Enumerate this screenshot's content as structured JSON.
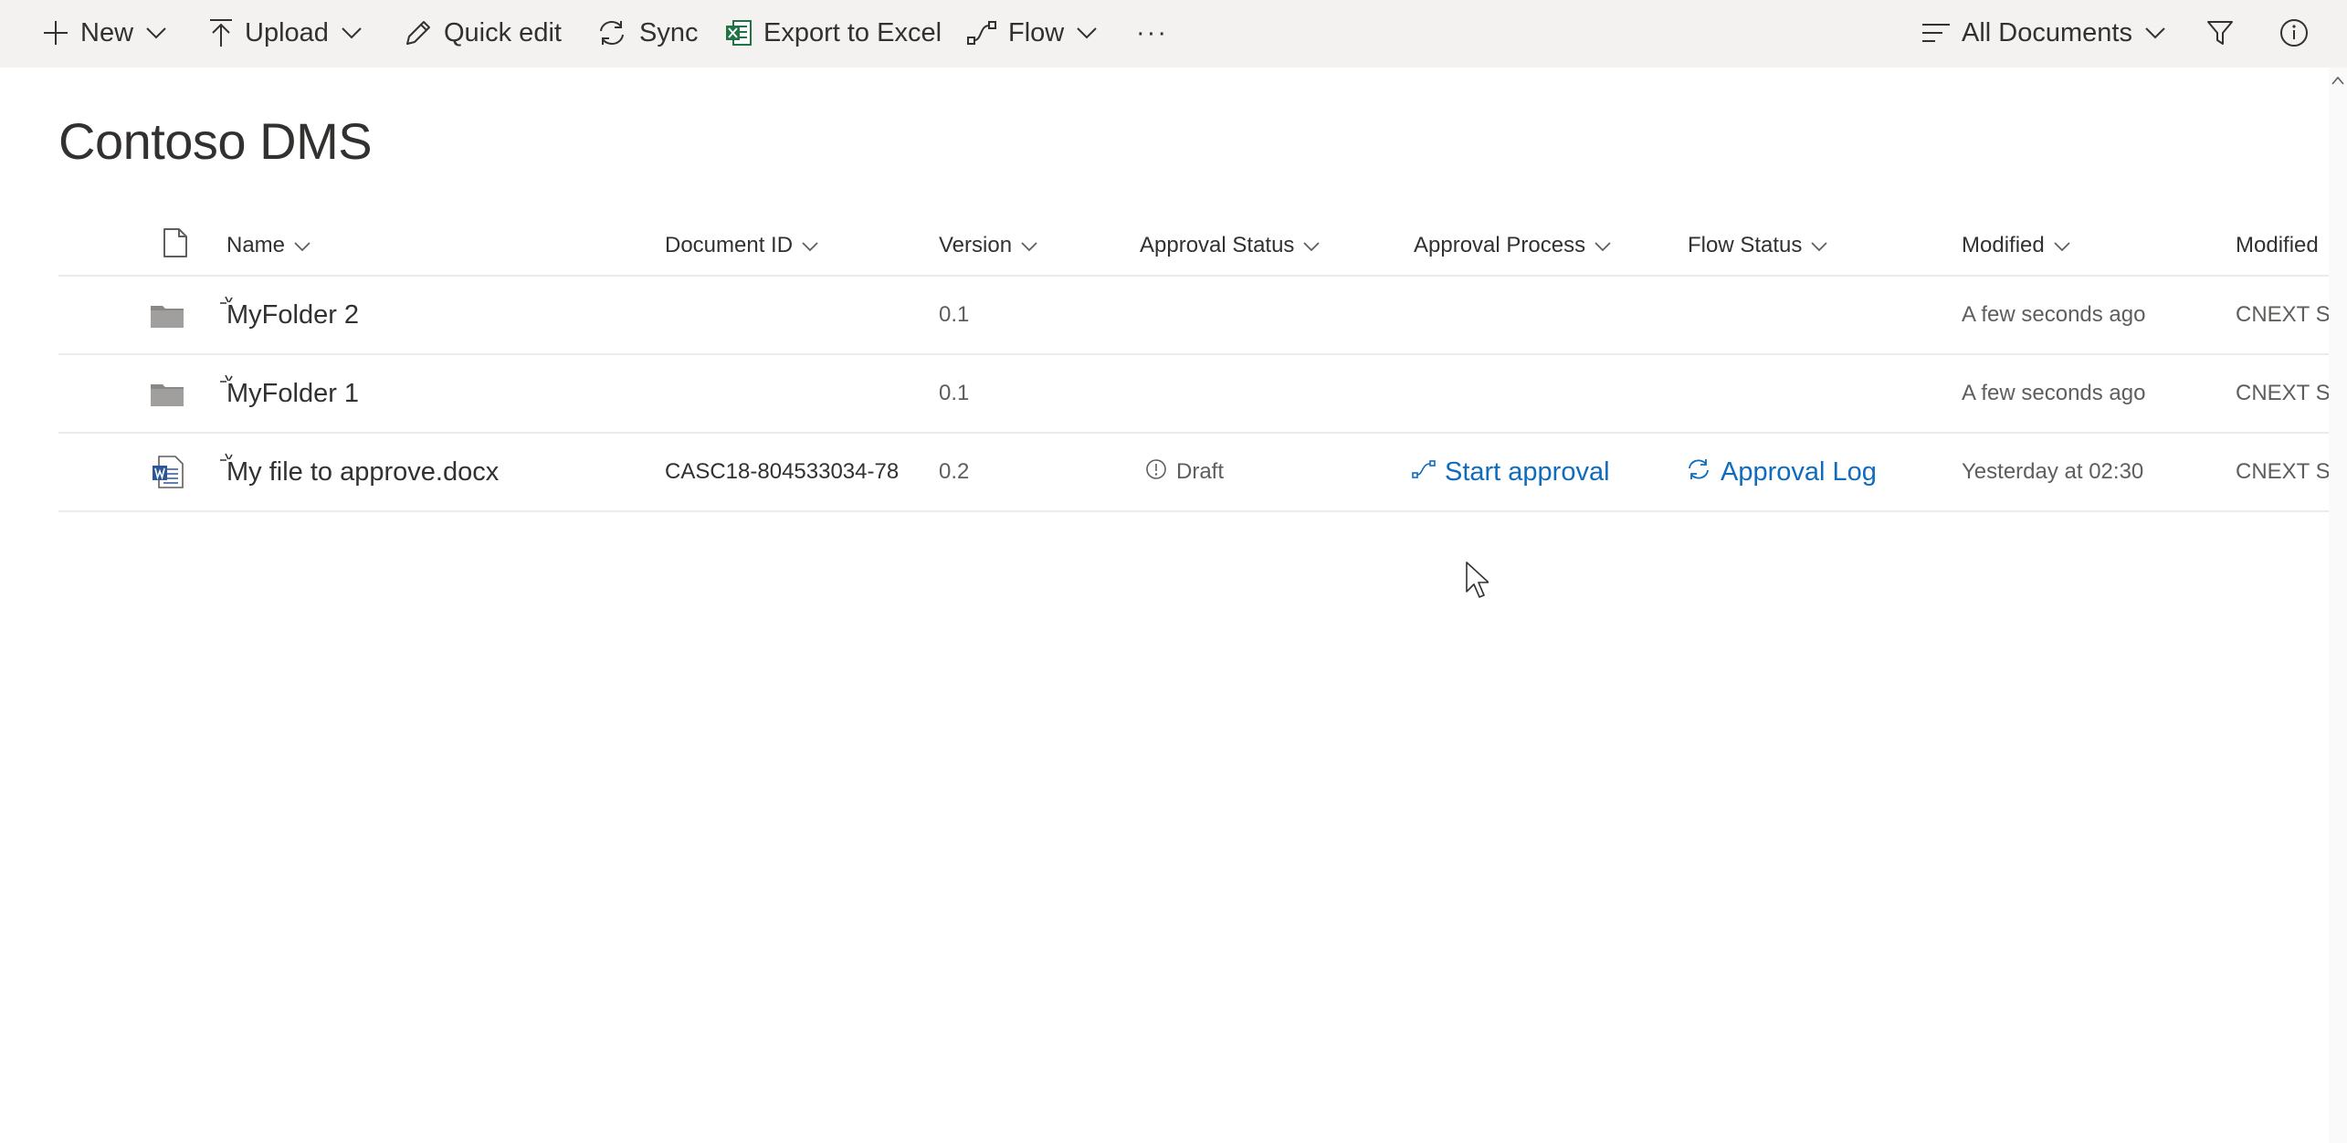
{
  "command_bar": {
    "new_label": "New",
    "upload_label": "Upload",
    "quick_edit_label": "Quick edit",
    "sync_label": "Sync",
    "export_label": "Export to Excel",
    "flow_label": "Flow",
    "more_label": "···",
    "view_label": "All Documents"
  },
  "library": {
    "title": "Contoso DMS"
  },
  "columns": {
    "name": "Name",
    "document_id": "Document ID",
    "version": "Version",
    "approval_status": "Approval Status",
    "approval_process": "Approval Process",
    "flow_status": "Flow Status",
    "modified": "Modified",
    "modified_by": "Modified"
  },
  "rows": [
    {
      "type": "folder",
      "name": "MyFolder 2",
      "document_id": "",
      "version": "0.1",
      "approval_status": "",
      "approval_process": "",
      "flow_status": "",
      "modified": "A few seconds ago",
      "modified_by": "CNEXT Su"
    },
    {
      "type": "folder",
      "name": "MyFolder 1",
      "document_id": "",
      "version": "0.1",
      "approval_status": "",
      "approval_process": "",
      "flow_status": "",
      "modified": "A few seconds ago",
      "modified_by": "CNEXT Su"
    },
    {
      "type": "word",
      "name": "My file to approve.docx",
      "document_id": "CASC18-804533034-78",
      "version": "0.2",
      "approval_status": "Draft",
      "approval_process": "Start approval",
      "flow_status": "Approval Log",
      "modified": "Yesterday at 02:30",
      "modified_by": "CNEXT Su"
    }
  ],
  "colors": {
    "accent": "#0f6cbd",
    "command_bar_bg": "#f3f2f1",
    "divider": "#edebe9",
    "folder": "#8a8886",
    "excel": "#217346",
    "word": "#2b579a"
  }
}
